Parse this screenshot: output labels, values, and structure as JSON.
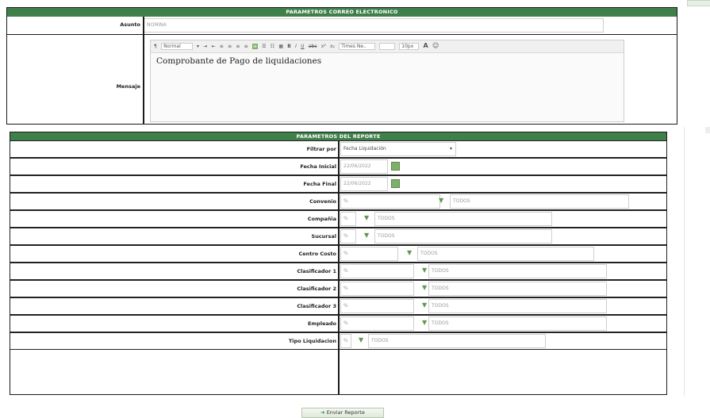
{
  "email_section": {
    "title": "PARAMETROS CORREO ELECTRONICO",
    "subject_label": "Asunto",
    "subject_value": "NOMINA",
    "message_label": "Mensaje",
    "message_body": "Comprobante de Pago de liquidaciones",
    "toolbar": {
      "format_select": "Normal",
      "font_select": "Times Ne..",
      "size_select": "10px",
      "bold": "B",
      "italic": "I",
      "underline": "U",
      "strike": "abc",
      "superscript": "x²",
      "subscript": "x₂",
      "font_color": "A",
      "emoji": "☺"
    }
  },
  "report_section": {
    "title": "PARAMETROS DEL REPORTE",
    "rows": [
      {
        "label": "Filtrar por",
        "value": "Fecha Liquidación"
      },
      {
        "label": "Fecha Inicial",
        "value": "22/06/2022"
      },
      {
        "label": "Fecha Final",
        "value": "22/06/2022"
      },
      {
        "label": "Convenio",
        "value": "%",
        "value2": "TODOS"
      },
      {
        "label": "Compañia",
        "value": "%",
        "value2": "TODOS"
      },
      {
        "label": "Sucursal",
        "value": "%",
        "value2": "TODOS"
      },
      {
        "label": "Centro Costo",
        "value": "%",
        "value2": "TODOS"
      },
      {
        "label": "Clasificador 1",
        "value": "%",
        "value2": "TODOS"
      },
      {
        "label": "Clasificador 2",
        "value": "%",
        "value2": "TODOS"
      },
      {
        "label": "Clasificador 3",
        "value": "%",
        "value2": "TODOS"
      },
      {
        "label": "Empleado",
        "value": "%",
        "value2": "TODOS"
      },
      {
        "label": "Tipo Liquidacion",
        "value": "%",
        "value2": "TODOS"
      }
    ]
  },
  "send_button": "Enviar Reporte",
  "icons": {
    "filter": "filter-icon",
    "calendar": "calendar-icon",
    "send": "send-icon"
  },
  "colors": {
    "header_green": "#3f7f4a",
    "filter_icon": "#5a9a4a"
  }
}
